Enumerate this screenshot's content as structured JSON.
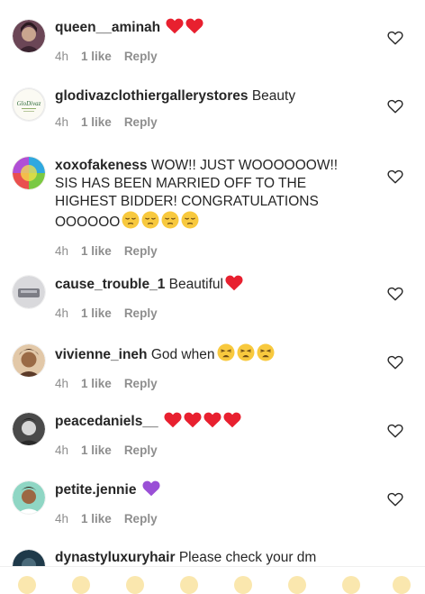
{
  "comments": [
    {
      "username": "queen__aminah",
      "text": "",
      "emojis": [
        "red-heart",
        "red-heart"
      ],
      "time": "4h",
      "likes": "1 like",
      "reply": "Reply"
    },
    {
      "username": "glodivazclothiergallerystores",
      "text": "Beauty",
      "emojis": [],
      "time": "4h",
      "likes": "1 like",
      "reply": "Reply",
      "avatar_logo_text": "GloDivaz"
    },
    {
      "username": "xoxofakeness",
      "text": "WOW!! JUST WOOOOOOW!! SIS HAS BEEN MARRIED OFF TO THE HIGHEST BIDDER! CONGRATULATIONS OOOOOO",
      "emojis": [
        "pensive-face",
        "pensive-face",
        "pensive-face",
        "pensive-face"
      ],
      "time": "4h",
      "likes": "1 like",
      "reply": "Reply"
    },
    {
      "username": "cause_trouble_1",
      "text": "Beautiful",
      "emojis": [
        "red-heart"
      ],
      "time": "4h",
      "likes": "1 like",
      "reply": "Reply"
    },
    {
      "username": "vivienne_ineh",
      "text": "God when",
      "emojis": [
        "weary-face",
        "weary-face",
        "weary-face"
      ],
      "time": "4h",
      "likes": "1 like",
      "reply": "Reply"
    },
    {
      "username": "peacedaniels__",
      "text": "",
      "emojis": [
        "red-heart",
        "red-heart",
        "red-heart",
        "red-heart"
      ],
      "time": "4h",
      "likes": "1 like",
      "reply": "Reply"
    },
    {
      "username": "petite.jennie",
      "text": "",
      "emojis": [
        "purple-heart"
      ],
      "time": "4h",
      "likes": "1 like",
      "reply": "Reply"
    },
    {
      "username": "dynastyluxuryhair",
      "text": "Please check your dm",
      "emojis": [],
      "time": "",
      "likes": "",
      "reply": ""
    }
  ],
  "colors": {
    "red_heart": "#e8202f",
    "purple_heart": "#9a4fd6",
    "meta_text": "#8e8e8e",
    "username": "#262626"
  },
  "icons": {
    "like": "heart-outline-icon"
  }
}
